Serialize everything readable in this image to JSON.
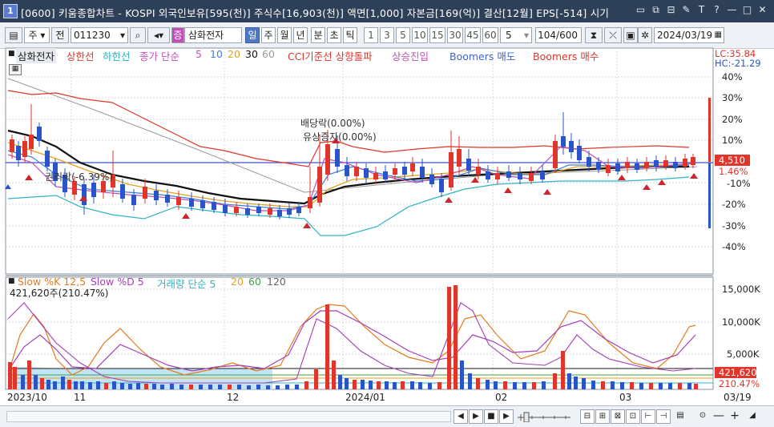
{
  "window": {
    "icon_label": "1",
    "title": "[0600] 키움종합차트 - KOSPI 외국인보유[595(천)] 주식수[16,903(천)] 액면[1,000] 자본금[169(억)] 결산[12월] EPS[-514] 시기",
    "buttons": [
      "▭",
      "⧉",
      "⊟",
      "✎",
      "T",
      "?",
      "—",
      "□",
      "✕"
    ]
  },
  "toolbar": {
    "period_value": "주",
    "prev_label": "전",
    "code_value": "011230",
    "stock_name": "삼화전자",
    "timeframes": [
      "일",
      "주",
      "월",
      "년",
      "분",
      "초",
      "틱"
    ],
    "active_timeframe": "일",
    "intervals": [
      "1",
      "3",
      "5",
      "10",
      "15",
      "30",
      "45",
      "60"
    ],
    "count_select": "5",
    "page_count": "104/600",
    "date_value": "2024/03/19"
  },
  "legend_top": {
    "items": [
      {
        "text": "삼화전자",
        "color": "#222222"
      },
      {
        "text": "상한선",
        "color": "#e0352b"
      },
      {
        "text": "하한선",
        "color": "#2fb3c3"
      },
      {
        "text": "종가 단순",
        "color": "#c24fb7"
      },
      {
        "text": "5",
        "color": "#c24fb7"
      },
      {
        "text": "10",
        "color": "#3d7fd8"
      },
      {
        "text": "20",
        "color": "#e5a11b"
      },
      {
        "text": "30",
        "color": "#111111"
      },
      {
        "text": "60",
        "color": "#999999"
      },
      {
        "text": "CCI기준선 상향돌파",
        "color": "#e0352b"
      },
      {
        "text": "상승진입",
        "color": "#c24fb7"
      },
      {
        "text": "Boomers 매도",
        "color": "#3d64d8"
      },
      {
        "text": "Boomers 매수",
        "color": "#e0352b"
      }
    ],
    "lc": "LC:35.84",
    "hc": "HC:-21.29"
  },
  "price_axis": {
    "ticks": [
      "40%",
      "30%",
      "20%",
      "10%",
      "0%",
      "-10%",
      "-20%",
      "-30%",
      "-40%"
    ],
    "current_price": "4,510",
    "current_pct": "1.46%"
  },
  "annotations": {
    "dividend": "배당락(0.00%)",
    "paid_in": "유상증자(0.00%)",
    "rights_off": "권리락(-6.39%)"
  },
  "legend_bottom": {
    "items": [
      {
        "text": "Slow %K 12,5",
        "color": "#e57a1b"
      },
      {
        "text": "Slow %D 5",
        "color": "#a43fb8"
      },
      {
        "text": "거래량 단순 5",
        "color": "#2fb3c3"
      },
      {
        "text": "20",
        "color": "#e5a11b"
      },
      {
        "text": "60",
        "color": "#3aa04a"
      },
      {
        "text": "120",
        "color": "#666666"
      }
    ],
    "volume_info": "421,620주(210.47%)"
  },
  "volume_axis": {
    "ticks": [
      "15,000K",
      "10,000K",
      "5,000K"
    ],
    "current_volume": "421,620",
    "current_pct": "210.47%"
  },
  "date_axis": {
    "labels": [
      "2023/10",
      "11",
      "12",
      "2024/01",
      "02",
      "03",
      "03/19"
    ]
  },
  "colors": {
    "up": "#e0352b",
    "down": "#2a55c8",
    "envelope_upper": "#e0352b",
    "envelope_lower": "#2fb3c3",
    "ma5": "#c24fb7",
    "ma10": "#3d7fd8",
    "ma20": "#e5a11b",
    "ma30": "#111111",
    "ma60": "#999999"
  },
  "bottom_bar": {
    "buttons": [
      "◀",
      "▶",
      "■",
      "▶",
      "▶|",
      "⊟",
      "⊞",
      "⊠",
      "⊡",
      "⊢",
      "⊣",
      "—",
      "+",
      "◢"
    ]
  }
}
